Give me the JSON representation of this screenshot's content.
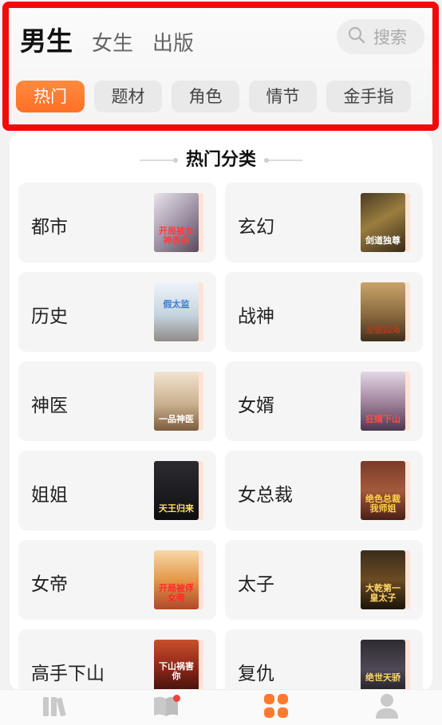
{
  "header": {
    "tabs": [
      {
        "label": "男生",
        "active": true
      },
      {
        "label": "女生",
        "active": false
      },
      {
        "label": "出版",
        "active": false
      }
    ],
    "search": {
      "placeholder": "搜索",
      "icon": "search-icon"
    },
    "chips": [
      {
        "label": "热门",
        "active": true
      },
      {
        "label": "题材",
        "active": false
      },
      {
        "label": "角色",
        "active": false
      },
      {
        "label": "情节",
        "active": false
      },
      {
        "label": "金手指",
        "active": false
      }
    ]
  },
  "section": {
    "title": "热门分类"
  },
  "categories": [
    {
      "label": "都市",
      "cover_title": "开局被女神表白"
    },
    {
      "label": "玄幻",
      "cover_title": "剑道独尊"
    },
    {
      "label": "历史",
      "cover_title": "假太监"
    },
    {
      "label": "战神",
      "cover_title": "龙傲四海"
    },
    {
      "label": "神医",
      "cover_title": "一品神医"
    },
    {
      "label": "女婿",
      "cover_title": "狂婿下山"
    },
    {
      "label": "姐姐",
      "cover_title": "天王归来"
    },
    {
      "label": "女总裁",
      "cover_title": "绝色总裁我师姐"
    },
    {
      "label": "女帝",
      "cover_title": "开局被俘女帝"
    },
    {
      "label": "太子",
      "cover_title": "大乾第一皇太子"
    },
    {
      "label": "高手下山",
      "cover_title": "下山祸害你"
    },
    {
      "label": "复仇",
      "cover_title": "绝世天骄"
    }
  ],
  "bottom_nav": [
    {
      "icon": "bookshelf-icon",
      "active": false,
      "badge": false
    },
    {
      "icon": "book-open-icon",
      "active": false,
      "badge": true
    },
    {
      "icon": "category-icon",
      "active": true,
      "badge": false
    },
    {
      "icon": "profile-icon",
      "active": false,
      "badge": false
    }
  ],
  "colors": {
    "accent": "#ff7a2f",
    "highlight_border": "#f20a0a",
    "badge": "#f0413a"
  }
}
